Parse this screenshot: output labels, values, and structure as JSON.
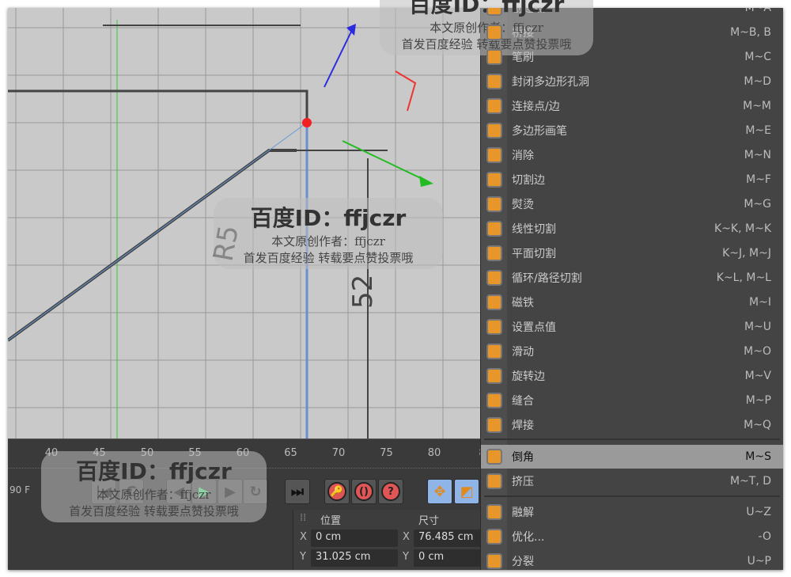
{
  "timeline": {
    "ticks": [
      "40",
      "45",
      "50",
      "55",
      "60",
      "65",
      "70",
      "75",
      "80",
      "8"
    ],
    "fps": "90 F"
  },
  "viewport": {
    "dimension_labels": [
      "R5",
      "52"
    ]
  },
  "coordinates": {
    "position_header": "位置",
    "size_header": "尺寸",
    "x_label": "X",
    "y_label": "Y",
    "pos_x": "0 cm",
    "size_x": "76.485 cm",
    "pos_y": "31.025 cm",
    "size_y": "0 cm"
  },
  "menu": {
    "items": [
      {
        "label": "创建点",
        "shortcut": "M~A"
      },
      {
        "label": "桥接",
        "shortcut": "M~B, B"
      },
      {
        "label": "笔刷",
        "shortcut": "M~C"
      },
      {
        "label": "封闭多边形孔洞",
        "shortcut": "M~D"
      },
      {
        "label": "连接点/边",
        "shortcut": "M~M"
      },
      {
        "label": "多边形画笔",
        "shortcut": "M~E"
      },
      {
        "label": "消除",
        "shortcut": "M~N"
      },
      {
        "label": "切割边",
        "shortcut": "M~F"
      },
      {
        "label": "熨烫",
        "shortcut": "M~G"
      },
      {
        "label": "线性切割",
        "shortcut": "K~K, M~K"
      },
      {
        "label": "平面切割",
        "shortcut": "K~J, M~J"
      },
      {
        "label": "循环/路径切割",
        "shortcut": "K~L, M~L"
      },
      {
        "label": "磁铁",
        "shortcut": "M~I"
      },
      {
        "label": "设置点值",
        "shortcut": "M~U"
      },
      {
        "label": "滑动",
        "shortcut": "M~O"
      },
      {
        "label": "旋转边",
        "shortcut": "M~V"
      },
      {
        "label": "缝合",
        "shortcut": "M~P"
      },
      {
        "label": "焊接",
        "shortcut": "M~Q"
      }
    ],
    "group2": [
      {
        "label": "倒角",
        "shortcut": "M~S"
      },
      {
        "label": "挤压",
        "shortcut": "M~T, D"
      }
    ],
    "group3": [
      {
        "label": "融解",
        "shortcut": "U~Z"
      },
      {
        "label": "优化...",
        "shortcut": "-O"
      },
      {
        "label": "分裂",
        "shortcut": "U~P"
      }
    ]
  },
  "watermark": {
    "title": "百度ID：ffjczr",
    "line1": "本文原创作者：ffjczr",
    "line2": "首发百度经验 转载要点赞投票哦"
  }
}
